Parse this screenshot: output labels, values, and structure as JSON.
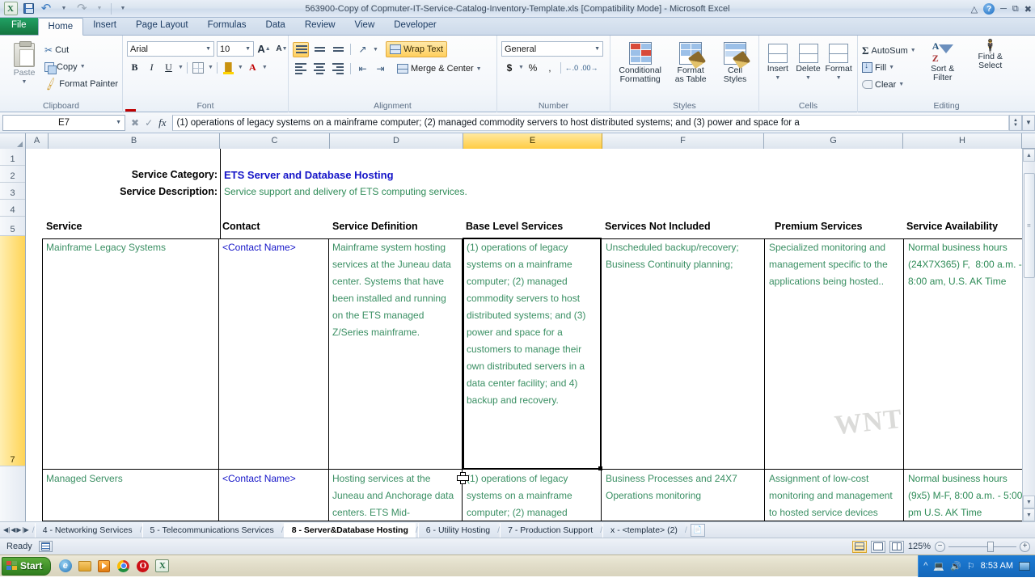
{
  "window": {
    "title": "563900-Copy of Copmuter-IT-Service-Catalog-Inventory-Template.xls [Compatibility Mode]  -  Microsoft Excel",
    "quick_access": [
      "save-icon",
      "undo-icon",
      "redo-icon",
      "customize-icon"
    ],
    "controls": [
      "ribbon-collapse-icon",
      "help-icon",
      "minimize-icon",
      "restore-icon",
      "close-icon"
    ]
  },
  "ribbon": {
    "tabs": [
      {
        "label": "File",
        "active": false
      },
      {
        "label": "Home",
        "active": true
      },
      {
        "label": "Insert",
        "active": false
      },
      {
        "label": "Page Layout",
        "active": false
      },
      {
        "label": "Formulas",
        "active": false
      },
      {
        "label": "Data",
        "active": false
      },
      {
        "label": "Review",
        "active": false
      },
      {
        "label": "View",
        "active": false
      },
      {
        "label": "Developer",
        "active": false
      }
    ],
    "groups": {
      "clipboard": {
        "label": "Clipboard",
        "paste": "Paste",
        "cut": "Cut",
        "copy": "Copy",
        "format_painter": "Format Painter"
      },
      "font": {
        "label": "Font",
        "font_name": "Arial",
        "font_size": "10",
        "grow_font": "A",
        "shrink_font": "A",
        "bold": "B",
        "italic": "I",
        "underline": "U"
      },
      "alignment": {
        "label": "Alignment",
        "wrap_text": "Wrap Text",
        "merge_center": "Merge & Center"
      },
      "number": {
        "label": "Number",
        "format": "General",
        "currency": "$",
        "percent": "%",
        "comma": ","
      },
      "styles": {
        "label": "Styles",
        "conditional_formatting": "Conditional\nFormatting",
        "conditional_formatting_l1": "Conditional",
        "conditional_formatting_l2": "Formatting",
        "format_as_table_l1": "Format",
        "format_as_table_l2": "as Table",
        "cell_styles_l1": "Cell",
        "cell_styles_l2": "Styles"
      },
      "cells": {
        "label": "Cells",
        "insert": "Insert",
        "delete": "Delete",
        "format": "Format"
      },
      "editing": {
        "label": "Editing",
        "autosum": "AutoSum",
        "fill": "Fill",
        "clear": "Clear",
        "sort_filter_l1": "Sort &",
        "sort_filter_l2": "Filter",
        "find_select_l1": "Find &",
        "find_select_l2": "Select"
      }
    }
  },
  "formula_bar": {
    "name_box": "E7",
    "formula": "(1) operations of legacy systems on a mainframe computer;  (2) managed commodity servers to host distributed systems; and (3) power and space for a"
  },
  "grid": {
    "column_headers": [
      "A",
      "B",
      "C",
      "D",
      "E",
      "F",
      "G",
      "H"
    ],
    "selected_column": "E",
    "row_headers": [
      "1",
      "2",
      "3",
      "4",
      "5",
      "7"
    ],
    "selected_row": "7",
    "labels": {
      "service_category_label": "Service Category:",
      "service_category_value": "ETS Server and Database Hosting",
      "service_description_label": "Service Description:",
      "service_description_value": "Service support and delivery of ETS computing services."
    },
    "table_headers": [
      "Service",
      "Contact",
      "Service Definition",
      "Base Level Services",
      "Services Not Included",
      "Premium Services",
      "Service Availability"
    ],
    "rows": [
      {
        "service": "Mainframe Legacy Systems",
        "contact": "<Contact Name>",
        "definition": "Mainframe system hosting services at the Juneau data center. Systems that have been installed and running on the ETS managed Z/Series mainframe.",
        "base_level": "(1) operations of legacy systems on a mainframe computer; (2) managed commodity servers to host distributed systems; and (3) power and space for a customers to manage their own distributed servers in a data center facility; and 4) backup and recovery.",
        "not_included": "Unscheduled backup/recovery; Business Continuity planning;",
        "premium": "Specialized monitoring and management specific to the applications being hosted..",
        "availability": "Normal business hours (24X7X365) F,  8:00 a.m. - 8:00 am, U.S. AK Time"
      },
      {
        "service": "Managed Servers",
        "contact": "<Contact Name>",
        "definition": "Hosting services at the Juneau and Anchorage data centers. ETS Mid-",
        "base_level": "(1) operations of legacy systems on a mainframe computer; (2) managed",
        "not_included": "Business Processes and 24X7 Operations monitoring",
        "premium": "Assignment of low-cost monitoring and management to hosted service devices",
        "availability": "Normal business hours (9x5) M-F, 8:00 a.m. - 5:00 pm U.S. AK Time"
      }
    ]
  },
  "sheet_tabs": {
    "tabs": [
      {
        "label": "4 - Networking Services",
        "active": false
      },
      {
        "label": "5 - Telecommunications Services",
        "active": false
      },
      {
        "label": "8 - Server&Database Hosting",
        "active": true
      },
      {
        "label": "6 - Utility Hosting",
        "active": false
      },
      {
        "label": "7 - Production Support",
        "active": false
      },
      {
        "label": "x - <template> (2)",
        "active": false
      }
    ],
    "new_sheet": "new-sheet-icon"
  },
  "status_bar": {
    "status": "Ready",
    "zoom": "125%",
    "views": [
      "normal-view-icon",
      "page-layout-view-icon",
      "page-break-view-icon"
    ]
  },
  "taskbar": {
    "start": "Start",
    "quick_launch": [
      "internet-explorer-icon",
      "file-explorer-icon",
      "media-player-icon",
      "chrome-icon",
      "opera-icon",
      "excel-icon"
    ],
    "clock": "8:53 AM"
  }
}
